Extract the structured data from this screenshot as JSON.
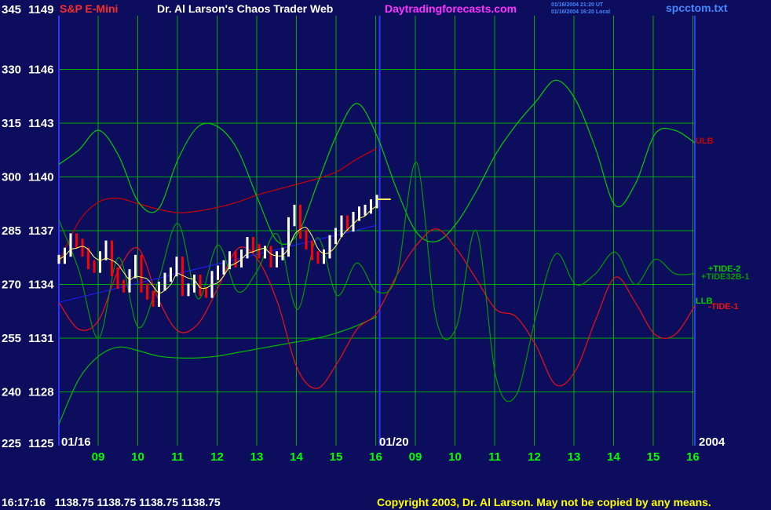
{
  "header": {
    "symbol_label": "S&P E-Mini",
    "author_title": "Dr. Al Larson's Chaos Trader Web",
    "site": "Daytradingforecasts.com",
    "timestamp_ut": "01/16/2004 21:20 UT",
    "timestamp_local": "01/16/2004 16:20 Local",
    "file_name": "spcctom.txt"
  },
  "footer": {
    "readout": "16:17:16   1138.75 1138.75 1138.75 1138.75",
    "copyright": "Copyright 2003, Dr. Al Larson. May not be copied by any means."
  },
  "colors": {
    "background": "#0d0d5e",
    "grid": "#00aa00",
    "divider": "#3333ff",
    "price_up": "#ffffff",
    "price_down": "#ff0000",
    "upper_band": "#cc0000",
    "lower_band": "#00bb00",
    "tide_2": "#00cc00",
    "tide_32b": "#009900",
    "tide_1": "#ee1111",
    "fit_line": "#1e1eff",
    "moving_average": "#ffff66",
    "title_red": "#ff2a2a",
    "title_white": "#ffffff",
    "title_magenta": "#ff33ff",
    "title_blue": "#4488ff",
    "axis_text": "#ffffff",
    "time_text": "#00ff00",
    "copyright": "#ffff00"
  },
  "chart_data": {
    "type": "line",
    "title": "S&P E-Mini",
    "y_left_ticks": [
      "345",
      "330",
      "315",
      "300",
      "285",
      "270",
      "255",
      "240",
      "225"
    ],
    "y_price_ticks": [
      "1149",
      "1146",
      "1143",
      "1140",
      "1137",
      "1134",
      "1131",
      "1128",
      "1125"
    ],
    "ylim": [
      1125,
      1149
    ],
    "x_hour_labels": [
      "09",
      "10",
      "11",
      "12",
      "13",
      "14",
      "15",
      "16",
      "09",
      "10",
      "11",
      "12",
      "13",
      "14",
      "15",
      "16"
    ],
    "x_date_labels": [
      "01/16",
      "01/20",
      "2004"
    ],
    "legend_labels": {
      "ulb": "ULB",
      "llb": "LLB",
      "tide2": "+TIDE-2",
      "tide32b": "+TIDE32B-1",
      "tide1": "-TIDE-1"
    },
    "series": [
      {
        "name": "ULB",
        "x": [
          0,
          0.5,
          1,
          1.5,
          2,
          2.5,
          3,
          3.5,
          4,
          4.5,
          5,
          5.5,
          6,
          6.5,
          7,
          7.5,
          8
        ],
        "values": [
          1135.2,
          1137.5,
          1138.6,
          1138.8,
          1138.5,
          1138.2,
          1138.0,
          1138.1,
          1138.3,
          1138.6,
          1139.0,
          1139.3,
          1139.6,
          1139.9,
          1140.3,
          1141.0,
          1141.6
        ]
      },
      {
        "name": "LLB",
        "x": [
          0,
          0.5,
          1,
          1.5,
          2,
          2.5,
          3,
          3.5,
          4,
          4.5,
          5,
          5.5,
          6,
          6.5,
          7,
          7.5,
          8
        ],
        "values": [
          1126.2,
          1128.7,
          1130.0,
          1130.5,
          1130.3,
          1130.0,
          1129.9,
          1129.9,
          1130.0,
          1130.2,
          1130.4,
          1130.6,
          1130.8,
          1131.0,
          1131.3,
          1131.7,
          1132.2
        ]
      },
      {
        "name": "+TIDE-2",
        "x": [
          0,
          0.5,
          1,
          1.5,
          2,
          2.5,
          3,
          3.5,
          4,
          4.5,
          5,
          5.5,
          6,
          6.5,
          7,
          7.5,
          8,
          8.5,
          9,
          9.5,
          10,
          10.5,
          11,
          11.5,
          12,
          12.5,
          13,
          13.5,
          14,
          14.5,
          15,
          15.5,
          16
        ],
        "values": [
          1140.7,
          1141.5,
          1142.6,
          1141.2,
          1138.6,
          1138.2,
          1141.0,
          1142.8,
          1142.8,
          1141.5,
          1138.8,
          1136.4,
          1136.8,
          1139.6,
          1142.4,
          1144.1,
          1142.3,
          1139.3,
          1136.9,
          1136.4,
          1137.4,
          1139.2,
          1141.3,
          1142.9,
          1144.2,
          1145.4,
          1144.3,
          1141.6,
          1138.4,
          1139.6,
          1142.4,
          1142.6,
          1141.9
        ]
      },
      {
        "name": "-TIDE-1",
        "x": [
          0,
          0.5,
          1,
          1.5,
          2,
          2.5,
          3,
          3.5,
          4,
          4.5,
          5,
          5.5,
          6,
          6.5,
          7,
          7.5,
          8,
          8.5,
          9,
          9.5,
          10,
          10.5,
          11,
          11.5,
          12,
          12.5,
          13,
          13.5,
          14,
          14.5,
          15,
          15.5,
          16
        ],
        "values": [
          1133.0,
          1131.5,
          1132.0,
          1134.8,
          1136.0,
          1133.2,
          1131.4,
          1131.8,
          1133.8,
          1136.0,
          1135.4,
          1133.0,
          1129.3,
          1128.2,
          1129.6,
          1131.5,
          1132.4,
          1134.5,
          1136.2,
          1137.1,
          1136.0,
          1134.3,
          1132.6,
          1132.2,
          1130.6,
          1128.4,
          1129.2,
          1132.0,
          1134.4,
          1133.0,
          1131.2,
          1131.2,
          1132.8
        ]
      },
      {
        "name": "+TIDE32B-1",
        "x": [
          0,
          0.5,
          1,
          1.5,
          2,
          2.5,
          3,
          3.5,
          4,
          4.5,
          5,
          5.5,
          6,
          6.5,
          7,
          7.5,
          8,
          8.5,
          9,
          9.5,
          10,
          10.5,
          11,
          11.5,
          12,
          12.5,
          13,
          13.5,
          14,
          14.5,
          15,
          15.5,
          16
        ],
        "values": [
          1137.6,
          1134.8,
          1131.0,
          1135.5,
          1131.6,
          1134.2,
          1137.4,
          1133.2,
          1136.2,
          1133.6,
          1134.8,
          1136.8,
          1132.6,
          1136.6,
          1133.4,
          1135.2,
          1133.6,
          1134.5,
          1140.8,
          1132.0,
          1131.6,
          1137.0,
          1128.8,
          1127.8,
          1132.2,
          1135.7,
          1134.0,
          1134.6,
          1135.8,
          1134.0,
          1135.4,
          1134.6,
          1134.6
        ]
      }
    ],
    "price": {
      "x_range": [
        0,
        8
      ],
      "closes": [
        1135.4,
        1135.8,
        1136.6,
        1136.3,
        1135.8,
        1135.1,
        1134.9,
        1135.6,
        1136.2,
        1134.7,
        1134.0,
        1133.8,
        1134.6,
        1135.4,
        1133.8,
        1133.4,
        1133.0,
        1133.9,
        1134.4,
        1134.7,
        1135.3,
        1133.6,
        1133.8,
        1134.3,
        1133.6,
        1133.5,
        1134.5,
        1134.8,
        1135.1,
        1135.6,
        1135.2,
        1135.7,
        1136.4,
        1136.0,
        1135.7,
        1135.9,
        1135.2,
        1135.6,
        1135.8,
        1137.5,
        1138.2,
        1136.8,
        1136.2,
        1135.6,
        1135.4,
        1135.7,
        1136.5,
        1136.9,
        1137.6,
        1137.2,
        1137.8,
        1138.1,
        1138.2,
        1138.5,
        1138.75
      ]
    },
    "fit_line": {
      "x": [
        0,
        8
      ],
      "values": [
        1133.0,
        1137.3
      ]
    },
    "forecast_tick": {
      "x": [
        8,
        8.35
      ],
      "values": [
        1138.75,
        1138.75
      ]
    }
  }
}
